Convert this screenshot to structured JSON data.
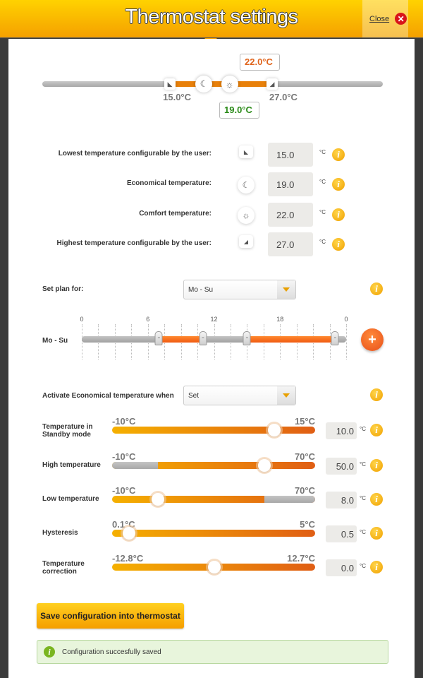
{
  "header": {
    "title": "Thermostat settings",
    "close_label": "Close",
    "close_icon": "close-x-icon"
  },
  "range_slider": {
    "min_value": 15.0,
    "economical_value": 19.0,
    "comfort_value": 22.0,
    "max_value": 27.0,
    "scale_min": 0,
    "scale_max": 40,
    "min_label": "15.0°C",
    "max_label": "27.0°C",
    "economical_label": "19.0°C",
    "comfort_label": "22.0°C",
    "colors": {
      "fill": "#e8800a",
      "economical": "#2a8a18",
      "comfort": "#e0641c"
    }
  },
  "temperatures": [
    {
      "label": "Lowest temperature configurable by the user:",
      "icon": "lowest-triangle-icon",
      "value": "15.0",
      "unit": "°C"
    },
    {
      "label": "Economical temperature:",
      "icon": "moon-icon",
      "value": "19.0",
      "unit": "°C"
    },
    {
      "label": "Comfort temperature:",
      "icon": "sun-icon",
      "value": "22.0",
      "unit": "°C"
    },
    {
      "label": "Highest temperature configurable by the user:",
      "icon": "highest-triangle-icon",
      "value": "27.0",
      "unit": "°C"
    }
  ],
  "plan": {
    "label": "Set plan for:",
    "selected": "Mo - Su",
    "row_label": "Mo - Su",
    "hour_labels": [
      "0",
      "6",
      "12",
      "18",
      "0"
    ],
    "comfort_periods": [
      {
        "start_hour": 7.0,
        "end_hour": 11.0
      },
      {
        "start_hour": 15.0,
        "end_hour": 23.0
      }
    ],
    "add_button": "+"
  },
  "eco_activation": {
    "label": "Activate Economical temperature when",
    "selected": "Set"
  },
  "parameters": [
    {
      "label": "Temperature in Standby mode",
      "min_label": "-10°C",
      "max_label": "15°C",
      "min": -10,
      "max": 15,
      "value": 10.0,
      "display": "10.0",
      "unit": "°C",
      "range_type": "full"
    },
    {
      "label": "High temperature",
      "min_label": "-10°C",
      "max_label": "70°C",
      "min": -10,
      "max": 70,
      "value": 50.0,
      "display": "50.0",
      "unit": "°C",
      "active_from": 8.0,
      "range_type": "upper"
    },
    {
      "label": "Low temperature",
      "min_label": "-10°C",
      "max_label": "70°C",
      "min": -10,
      "max": 70,
      "value": 8.0,
      "display": "8.0",
      "unit": "°C",
      "active_to": 50.0,
      "range_type": "lower"
    },
    {
      "label": "Hysteresis",
      "min_label": "0.1°C",
      "max_label": "5°C",
      "min": 0.1,
      "max": 5,
      "value": 0.5,
      "display": "0.5",
      "unit": "°C",
      "range_type": "full"
    },
    {
      "label": "Temperature correction",
      "min_label": "-12.8°C",
      "max_label": "12.7°C",
      "min": -12.8,
      "max": 12.7,
      "value": 0.0,
      "display": "0.0",
      "unit": "°C",
      "range_type": "full"
    }
  ],
  "save_button": "Save configuration into thermostat",
  "status": {
    "message": "Configuration succesfully saved",
    "color": "#7ab520"
  }
}
